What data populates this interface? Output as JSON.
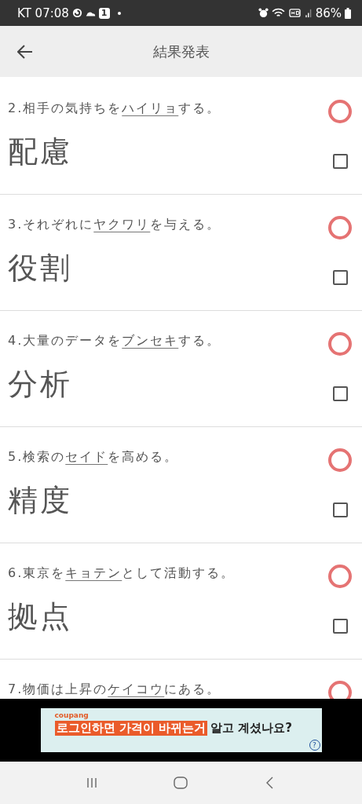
{
  "status_bar": {
    "carrier_time": "KT 07:08",
    "notification_count": "1",
    "battery": "86%"
  },
  "header": {
    "title": "結果発表"
  },
  "questions": [
    {
      "number": "2.",
      "before": "相手の気持ちを",
      "underlined": "ハイリョ",
      "after": "する。",
      "answer": "配慮",
      "correct": true,
      "checked": false
    },
    {
      "number": "3.",
      "before": "それぞれに",
      "underlined": "ヤクワリ",
      "after": "を与える。",
      "answer": "役割",
      "correct": true,
      "checked": false
    },
    {
      "number": "4.",
      "before": "大量のデータを",
      "underlined": "ブンセキ",
      "after": "する。",
      "answer": "分析",
      "correct": true,
      "checked": false
    },
    {
      "number": "5.",
      "before": "検索の",
      "underlined": "セイド",
      "after": "を高める。",
      "answer": "精度",
      "correct": true,
      "checked": false
    },
    {
      "number": "6.",
      "before": "東京を",
      "underlined": "キョテン",
      "after": "として活動する。",
      "answer": "拠点",
      "correct": true,
      "checked": false
    },
    {
      "number": "7.",
      "before": "物価は上昇の",
      "underlined": "ケイコウ",
      "after": "にある。",
      "correct": true
    }
  ],
  "ad": {
    "brand": "coupang",
    "highlight": "로그인하면 가격이 바뀌는거",
    "text": "알고 계셨나요?",
    "help": "?"
  }
}
